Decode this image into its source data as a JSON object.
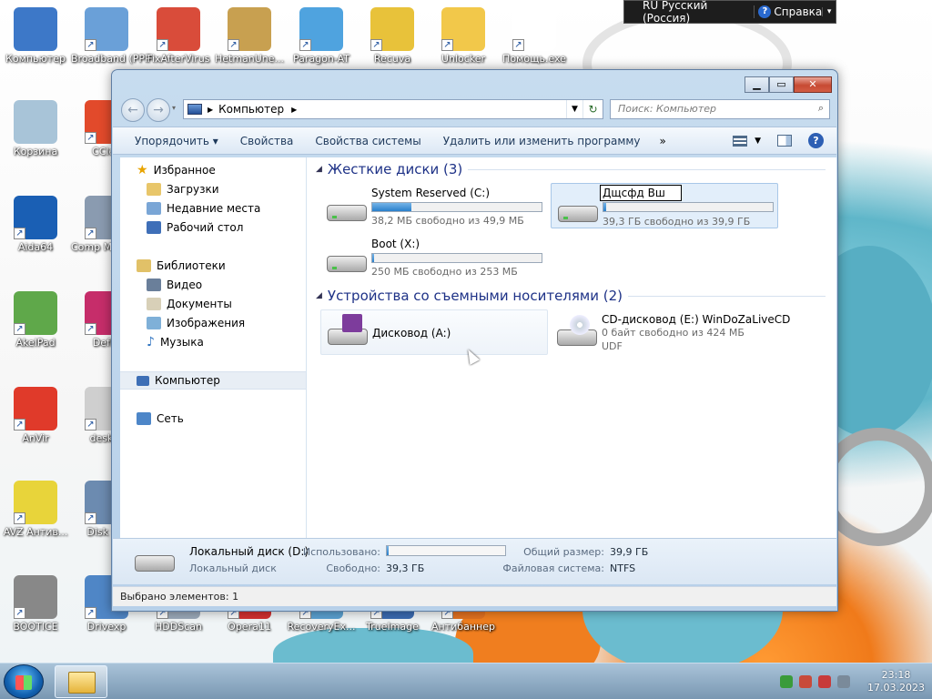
{
  "desktop_icons": [
    {
      "label": "Компьютер",
      "color": "#3d78c8"
    },
    {
      "label": "Broadband (PPP",
      "color": "#6aa0d8"
    },
    {
      "label": "FixAfterVirus",
      "color": "#d94c3a"
    },
    {
      "label": "HetmanUne...",
      "color": "#c8a050"
    },
    {
      "label": "Paragon-AT",
      "color": "#4fa3df"
    },
    {
      "label": "Recuva",
      "color": "#e8c23a"
    },
    {
      "label": "Unlocker",
      "color": "#f2c84a"
    },
    {
      "label": "Помощь.exe",
      "color": "#ffffff"
    },
    {
      "label": "Корзина",
      "color": "#a8c4d8"
    },
    {
      "label": "CClea",
      "color": "#e24a2b"
    },
    {
      "label": "Aida64",
      "color": "#1a5fb4"
    },
    {
      "label": "Comp Manage",
      "color": "#8a9bb0"
    },
    {
      "label": "AkelPad",
      "color": "#5fa84a"
    },
    {
      "label": "Defra",
      "color": "#c62d6a"
    },
    {
      "label": "AnVir",
      "color": "#e03a2a"
    },
    {
      "label": "deskto",
      "color": "#cfcfcf"
    },
    {
      "label": "AVZ Антив...",
      "color": "#e8d43a"
    },
    {
      "label": "Disk Dri",
      "color": "#6c8bb0"
    },
    {
      "label": "BOOTICE",
      "color": "#888888"
    },
    {
      "label": "Drivexp",
      "color": "#4f86c6"
    },
    {
      "label": "HDDScan",
      "color": "#9aa8b8"
    },
    {
      "label": "Opera11",
      "color": "#d23030"
    },
    {
      "label": "RecoveryEx...",
      "color": "#5aa0d0"
    },
    {
      "label": "TrueImage",
      "color": "#3a6ab0"
    },
    {
      "label": "Антибаннер",
      "color": "#e07020"
    }
  ],
  "langbar": {
    "lang": "RU Русский (Россия)",
    "help": "Справка"
  },
  "window": {
    "breadcrumb": "Компьютер",
    "search_placeholder": "Поиск: Компьютер",
    "toolbar": [
      "Упорядочить",
      "Свойства",
      "Свойства системы",
      "Удалить или изменить программу"
    ],
    "toolbar_more": "»",
    "nav": {
      "favorites": "Избранное",
      "favorites_items": [
        "Загрузки",
        "Недавние места",
        "Рабочий стол"
      ],
      "libraries": "Библиотеки",
      "library_items": [
        "Видео",
        "Документы",
        "Изображения",
        "Музыка"
      ],
      "computer": "Компьютер",
      "network": "Сеть"
    },
    "groups": {
      "hdd": "Жесткие диски (3)",
      "removable": "Устройства со съемными носителями (2)"
    },
    "drives": [
      {
        "name": "System Reserved (C:)",
        "free": "38,2 МБ свободно из 49,9 МБ",
        "used": 0.23
      },
      {
        "name": "Дщсфд Вш",
        "free": "39,3 ГБ свободно из 39,9 ГБ",
        "used": 0.015
      },
      {
        "name": "Boot (X:)",
        "free": "250 МБ свободно из 253 МБ",
        "used": 0.012
      }
    ],
    "removable": [
      {
        "name": "Дисковод (A:)"
      },
      {
        "name": "CD-дисковод (E:) WinDoZaLiveCD",
        "line2": "0 байт свободно из 424 МБ",
        "line3": "UDF"
      }
    ],
    "details": {
      "name": "Локальный диск (D:)",
      "type": "Локальный диск",
      "used_label": "Использовано:",
      "used": 0.015,
      "free_label": "Свободно:",
      "free": "39,3 ГБ",
      "total_label": "Общий размер:",
      "total": "39,9 ГБ",
      "fs_label": "Файловая система:",
      "fs": "NTFS"
    },
    "status": "Выбрано элементов: 1"
  },
  "taskbar": {
    "time": "23:18",
    "date": "17.03.2023"
  }
}
